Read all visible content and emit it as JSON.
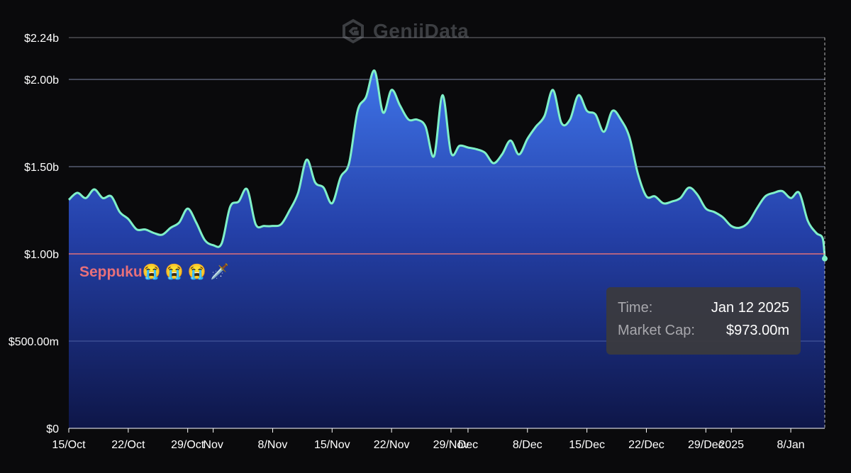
{
  "watermark": {
    "text": "GeniiData",
    "icon": "geniidata-logo-icon"
  },
  "annotation": {
    "text": "Seppuku😭 😭 😭 🗡️"
  },
  "tooltip": {
    "time_label": "Time:",
    "time_value": "Jan 12 2025",
    "mcap_label": "Market Cap:",
    "mcap_value": "$973.00m"
  },
  "colors": {
    "line": "#7ff0c8",
    "area_top": "#3f6fe0",
    "area_bottom": "#0d1540",
    "reference_line": "#e0707a",
    "background": "#0a0a0c"
  },
  "chart_data": {
    "type": "area",
    "title": "",
    "xlabel": "",
    "ylabel": "Market Cap",
    "ylim": [
      0,
      2240000000
    ],
    "yticks": [
      {
        "value": 0,
        "label": "$0"
      },
      {
        "value": 500000000,
        "label": "$500.00m"
      },
      {
        "value": 1000000000,
        "label": "$1.00b"
      },
      {
        "value": 1500000000,
        "label": "$1.50b"
      },
      {
        "value": 2000000000,
        "label": "$2.00b"
      },
      {
        "value": 2240000000,
        "label": "$2.24b"
      }
    ],
    "xrange": [
      "2024-10-15",
      "2025-01-12"
    ],
    "xticks": [
      {
        "date": "2024-10-15",
        "label": "15/Oct"
      },
      {
        "date": "2024-10-22",
        "label": "22/Oct"
      },
      {
        "date": "2024-10-29",
        "label": "29/Oct"
      },
      {
        "date": "2024-11-01",
        "label": "Nov"
      },
      {
        "date": "2024-11-08",
        "label": "8/Nov"
      },
      {
        "date": "2024-11-15",
        "label": "15/Nov"
      },
      {
        "date": "2024-11-22",
        "label": "22/Nov"
      },
      {
        "date": "2024-11-29",
        "label": "29/Nov"
      },
      {
        "date": "2024-12-01",
        "label": "Dec"
      },
      {
        "date": "2024-12-08",
        "label": "8/Dec"
      },
      {
        "date": "2024-12-15",
        "label": "15/Dec"
      },
      {
        "date": "2024-12-22",
        "label": "22/Dec"
      },
      {
        "date": "2024-12-29",
        "label": "29/Dec"
      },
      {
        "date": "2025-01-01",
        "label": "2025"
      },
      {
        "date": "2025-01-08",
        "label": "8/Jan"
      }
    ],
    "grid": true,
    "reference_line": {
      "value": 1000000000
    },
    "series": [
      {
        "points": [
          [
            "2024-10-15",
            1310000000.0
          ],
          [
            "2024-10-16",
            1350000000.0
          ],
          [
            "2024-10-17",
            1320000000.0
          ],
          [
            "2024-10-18",
            1370000000.0
          ],
          [
            "2024-10-19",
            1320000000.0
          ],
          [
            "2024-10-20",
            1330000000.0
          ],
          [
            "2024-10-21",
            1240000000.0
          ],
          [
            "2024-10-22",
            1200000000.0
          ],
          [
            "2024-10-23",
            1140000000.0
          ],
          [
            "2024-10-24",
            1140000000.0
          ],
          [
            "2024-10-25",
            1120000000.0
          ],
          [
            "2024-10-26",
            1110000000.0
          ],
          [
            "2024-10-27",
            1150000000.0
          ],
          [
            "2024-10-28",
            1180000000.0
          ],
          [
            "2024-10-29",
            1260000000.0
          ],
          [
            "2024-10-30",
            1180000000.0
          ],
          [
            "2024-10-31",
            1080000000.0
          ],
          [
            "2024-11-01",
            1050000000.0
          ],
          [
            "2024-11-02",
            1060000000.0
          ],
          [
            "2024-11-03",
            1270000000.0
          ],
          [
            "2024-11-04",
            1300000000.0
          ],
          [
            "2024-11-05",
            1370000000.0
          ],
          [
            "2024-11-06",
            1170000000.0
          ],
          [
            "2024-11-07",
            1160000000.0
          ],
          [
            "2024-11-08",
            1160000000.0
          ],
          [
            "2024-11-09",
            1170000000.0
          ],
          [
            "2024-11-10",
            1250000000.0
          ],
          [
            "2024-11-11",
            1350000000.0
          ],
          [
            "2024-11-12",
            1540000000.0
          ],
          [
            "2024-11-13",
            1410000000.0
          ],
          [
            "2024-11-14",
            1380000000.0
          ],
          [
            "2024-11-15",
            1290000000.0
          ],
          [
            "2024-11-16",
            1440000000.0
          ],
          [
            "2024-11-17",
            1520000000.0
          ],
          [
            "2024-11-18",
            1820000000.0
          ],
          [
            "2024-11-19",
            1900000000.0
          ],
          [
            "2024-11-20",
            2050000000.0
          ],
          [
            "2024-11-21",
            1810000000.0
          ],
          [
            "2024-11-22",
            1940000000.0
          ],
          [
            "2024-11-23",
            1850000000.0
          ],
          [
            "2024-11-24",
            1770000000.0
          ],
          [
            "2024-11-25",
            1770000000.0
          ],
          [
            "2024-11-26",
            1730000000.0
          ],
          [
            "2024-11-27",
            1560000000.0
          ],
          [
            "2024-11-28",
            1910000000.0
          ],
          [
            "2024-11-29",
            1580000000.0
          ],
          [
            "2024-11-30",
            1620000000.0
          ],
          [
            "2024-12-01",
            1610000000.0
          ],
          [
            "2024-12-02",
            1600000000.0
          ],
          [
            "2024-12-03",
            1580000000.0
          ],
          [
            "2024-12-04",
            1520000000.0
          ],
          [
            "2024-12-05",
            1570000000.0
          ],
          [
            "2024-12-06",
            1650000000.0
          ],
          [
            "2024-12-07",
            1570000000.0
          ],
          [
            "2024-12-08",
            1660000000.0
          ],
          [
            "2024-12-09",
            1730000000.0
          ],
          [
            "2024-12-10",
            1790000000.0
          ],
          [
            "2024-12-11",
            1940000000.0
          ],
          [
            "2024-12-12",
            1750000000.0
          ],
          [
            "2024-12-13",
            1770000000.0
          ],
          [
            "2024-12-14",
            1910000000.0
          ],
          [
            "2024-12-15",
            1820000000.0
          ],
          [
            "2024-12-16",
            1800000000.0
          ],
          [
            "2024-12-17",
            1700000000.0
          ],
          [
            "2024-12-18",
            1820000000.0
          ],
          [
            "2024-12-19",
            1770000000.0
          ],
          [
            "2024-12-20",
            1670000000.0
          ],
          [
            "2024-12-21",
            1460000000.0
          ],
          [
            "2024-12-22",
            1330000000.0
          ],
          [
            "2024-12-23",
            1330000000.0
          ],
          [
            "2024-12-24",
            1290000000.0
          ],
          [
            "2024-12-25",
            1300000000.0
          ],
          [
            "2024-12-26",
            1320000000.0
          ],
          [
            "2024-12-27",
            1380000000.0
          ],
          [
            "2024-12-28",
            1340000000.0
          ],
          [
            "2024-12-29",
            1260000000.0
          ],
          [
            "2024-12-30",
            1240000000.0
          ],
          [
            "2024-12-31",
            1210000000.0
          ],
          [
            "2025-01-01",
            1160000000.0
          ],
          [
            "2025-01-02",
            1150000000.0
          ],
          [
            "2025-01-03",
            1180000000.0
          ],
          [
            "2025-01-04",
            1260000000.0
          ],
          [
            "2025-01-05",
            1330000000.0
          ],
          [
            "2025-01-06",
            1350000000.0
          ],
          [
            "2025-01-07",
            1360000000.0
          ],
          [
            "2025-01-08",
            1320000000.0
          ],
          [
            "2025-01-09",
            1350000000.0
          ],
          [
            "2025-01-10",
            1190000000.0
          ],
          [
            "2025-01-11",
            1120000000.0
          ],
          [
            "2025-01-11T18:00",
            1090000000.0
          ],
          [
            "2025-01-12",
            973000000.0
          ]
        ]
      }
    ]
  }
}
